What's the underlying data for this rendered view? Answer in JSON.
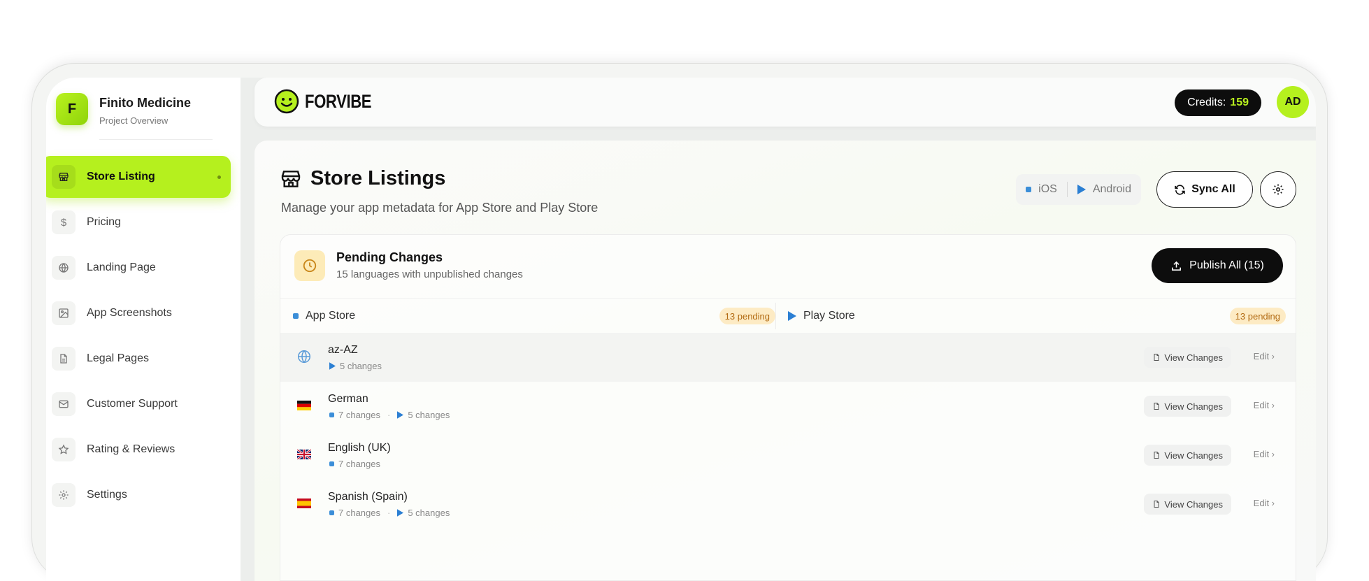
{
  "project": {
    "initial": "F",
    "name": "Finito Medicine",
    "subtitle": "Project Overview"
  },
  "sidebar": {
    "items": [
      {
        "label": "Store Listing",
        "icon": "store-icon",
        "active": true
      },
      {
        "label": "Pricing",
        "icon": "dollar-icon"
      },
      {
        "label": "Landing Page",
        "icon": "globe-icon"
      },
      {
        "label": "App Screenshots",
        "icon": "image-icon"
      },
      {
        "label": "Legal Pages",
        "icon": "document-icon"
      },
      {
        "label": "Customer Support",
        "icon": "mail-icon"
      },
      {
        "label": "Rating & Reviews",
        "icon": "star-icon"
      },
      {
        "label": "Settings",
        "icon": "gear-icon"
      }
    ]
  },
  "topbar": {
    "brand": "FORVIBE",
    "credits_label": "Credits:",
    "credits_value": "159",
    "avatar": "AD"
  },
  "page": {
    "title": "Store Listings",
    "subtitle": "Manage your app metadata for App Store and Play Store",
    "platform_ios": "iOS",
    "platform_android": "Android",
    "sync_label": "Sync All"
  },
  "pending": {
    "title": "Pending Changes",
    "subtitle": "15 languages with unpublished changes",
    "publish_label": "Publish All (15)",
    "app_store_label": "App Store",
    "app_store_pending": "13 pending",
    "play_store_label": "Play Store",
    "play_store_pending": "13 pending",
    "view_label": "View Changes",
    "edit_label": "Edit ›",
    "languages": [
      {
        "name": "az-AZ",
        "flag": "globe",
        "ios": "",
        "android": "5 changes"
      },
      {
        "name": "German",
        "flag": "de",
        "ios": "7 changes",
        "android": "5 changes"
      },
      {
        "name": "English (UK)",
        "flag": "uk",
        "ios": "7 changes",
        "android": ""
      },
      {
        "name": "Spanish (Spain)",
        "flag": "es",
        "ios": "7 changes",
        "android": "5 changes"
      }
    ]
  },
  "colors": {
    "accent": "#b5f01e",
    "ios_blue": "#3b8ed8",
    "pending_bg": "#fdebc4"
  }
}
